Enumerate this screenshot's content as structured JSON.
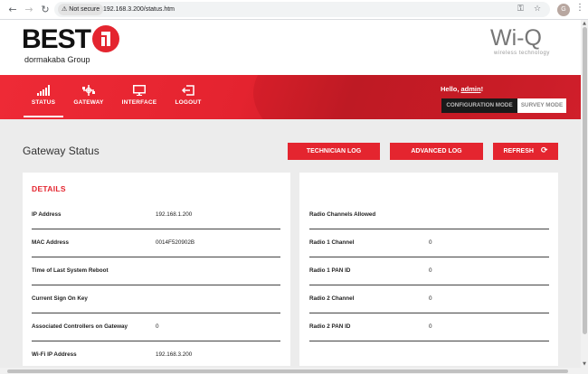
{
  "browser": {
    "security_label": "Not secure",
    "url": "192.168.3.200/status.htm",
    "profile_initial": "G"
  },
  "header": {
    "brand": "BEST",
    "brand_sub": "dormakaba Group",
    "product": "Wi-Q",
    "product_sub": "wireless technology"
  },
  "nav": {
    "items": [
      {
        "label": "STATUS",
        "icon": "signal-bars-icon",
        "active": true
      },
      {
        "label": "GATEWAY",
        "icon": "gateway-icon",
        "active": false
      },
      {
        "label": "INTERFACE",
        "icon": "monitor-icon",
        "active": false
      },
      {
        "label": "LOGOUT",
        "icon": "logout-icon",
        "active": false
      }
    ],
    "hello_prefix": "Hello, ",
    "user": "admin",
    "hello_suffix": "!",
    "config_mode": "CONFIGURATION MODE",
    "survey_mode": "SURVEY MODE"
  },
  "main": {
    "title": "Gateway Status",
    "buttons": {
      "technician_log": "TECHNICIAN LOG",
      "advanced_log": "ADVANCED LOG",
      "refresh": "REFRESH"
    },
    "details": {
      "title": "DETAILS",
      "rows": [
        {
          "label": "IP Address",
          "value": "192.168.1.200"
        },
        {
          "label": "MAC Address",
          "value": "0014F520902B"
        },
        {
          "label": "Time of Last System Reboot",
          "value": ""
        },
        {
          "label": "Current Sign On Key",
          "value": ""
        },
        {
          "label": "Associated Controllers on Gateway",
          "value": "0"
        },
        {
          "label": "Wi-Fi IP Address",
          "value": "192.168.3.200"
        }
      ]
    },
    "radio": {
      "rows": [
        {
          "label": "Radio Channels Allowed",
          "value": ""
        },
        {
          "label": "Radio 1 Channel",
          "value": "0"
        },
        {
          "label": "Radio 1 PAN ID",
          "value": "0"
        },
        {
          "label": "Radio 2 Channel",
          "value": "0"
        },
        {
          "label": "Radio 2 PAN ID",
          "value": "0"
        }
      ]
    }
  },
  "colors": {
    "brand_red": "#e4252f",
    "dark": "#1a1a1a"
  }
}
